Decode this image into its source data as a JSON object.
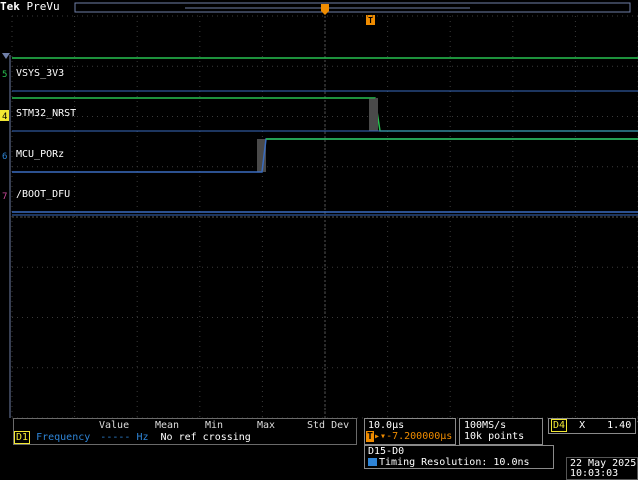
{
  "header": {
    "brand": "Tek",
    "mode": "PreVu"
  },
  "trigger_marker": "T",
  "traces": [
    {
      "channel": "5",
      "label": "VSYS_3V3",
      "color": "#27c250"
    },
    {
      "channel": "4",
      "label": "STM32_NRST",
      "color": "#f2e833"
    },
    {
      "channel": "6",
      "label": "MCU_PORz",
      "color": "#2e84d6"
    },
    {
      "channel": "7",
      "label": "/BOOT_DFU",
      "color": "#d04aa0"
    }
  ],
  "measurements": {
    "headers": [
      "Value",
      "Mean",
      "Min",
      "Max",
      "Std Dev"
    ],
    "row": {
      "source": "D1",
      "type": "Frequency",
      "dashes": "-----",
      "unit": "Hz",
      "status": "No ref crossing"
    }
  },
  "timebase": {
    "scale": "10.0µs",
    "trigger_icon": "T",
    "arrow": "▸▾",
    "offset": "-7.200000µs"
  },
  "acquisition": {
    "rate": "100MS/s",
    "points": "10k points"
  },
  "trigger": {
    "source": "D4",
    "slope_icon": "X",
    "level": "1.40 V"
  },
  "bus": {
    "name": "D15-D0",
    "timing": "Timing Resolution: 10.0ns"
  },
  "datetime": {
    "date": "22 May 2025",
    "time": "10:03:03"
  },
  "colors": {
    "grid": "#3a3a3a",
    "panel_border": "#8a8a8a",
    "trigger_orange": "#f08c00",
    "d1_color": "#2e84d6",
    "d1_badge": "#f2e833"
  }
}
